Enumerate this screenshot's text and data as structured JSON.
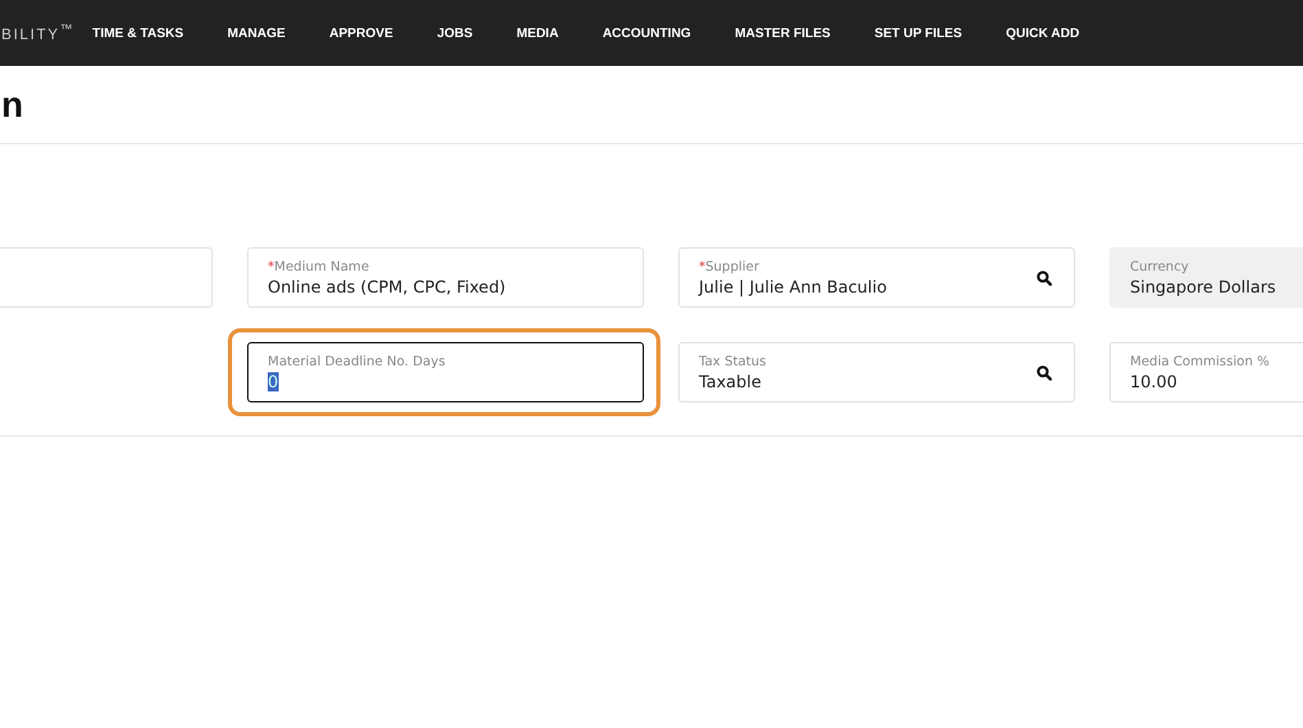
{
  "nav": {
    "brand": "BILITY$^{™}$",
    "items": [
      "TIME & TASKS",
      "MANAGE",
      "APPROVE",
      "JOBS",
      "MEDIA",
      "ACCOUNTING",
      "MASTER FILES",
      "SET UP FILES",
      "QUICK ADD"
    ]
  },
  "page_title": "n",
  "required_mark": "*",
  "form_rows": [
    [
      {
        "kind": "blank",
        "focused": false
      },
      {
        "kind": "text",
        "label": "Medium Name",
        "value": "Online ads (CPM, CPC, Fixed)",
        "required": true,
        "focused": false
      },
      {
        "kind": "search",
        "label": "Supplier",
        "value": "Julie | Julie Ann Baculio",
        "required": true,
        "focused": false
      },
      {
        "kind": "readonly",
        "label": "Currency",
        "value": "Singapore Dollars",
        "required": false,
        "focused": false
      }
    ],
    [
      {
        "kind": "none"
      },
      {
        "kind": "text",
        "label": "Material Deadline No. Days",
        "value": "0",
        "required": false,
        "focused": true
      },
      {
        "kind": "search",
        "label": "Tax Status",
        "value": "Taxable",
        "required": false,
        "focused": false
      },
      {
        "kind": "text",
        "label": "Media Commission %",
        "value": "10.00",
        "required": false,
        "focused": false
      }
    ]
  ]
}
